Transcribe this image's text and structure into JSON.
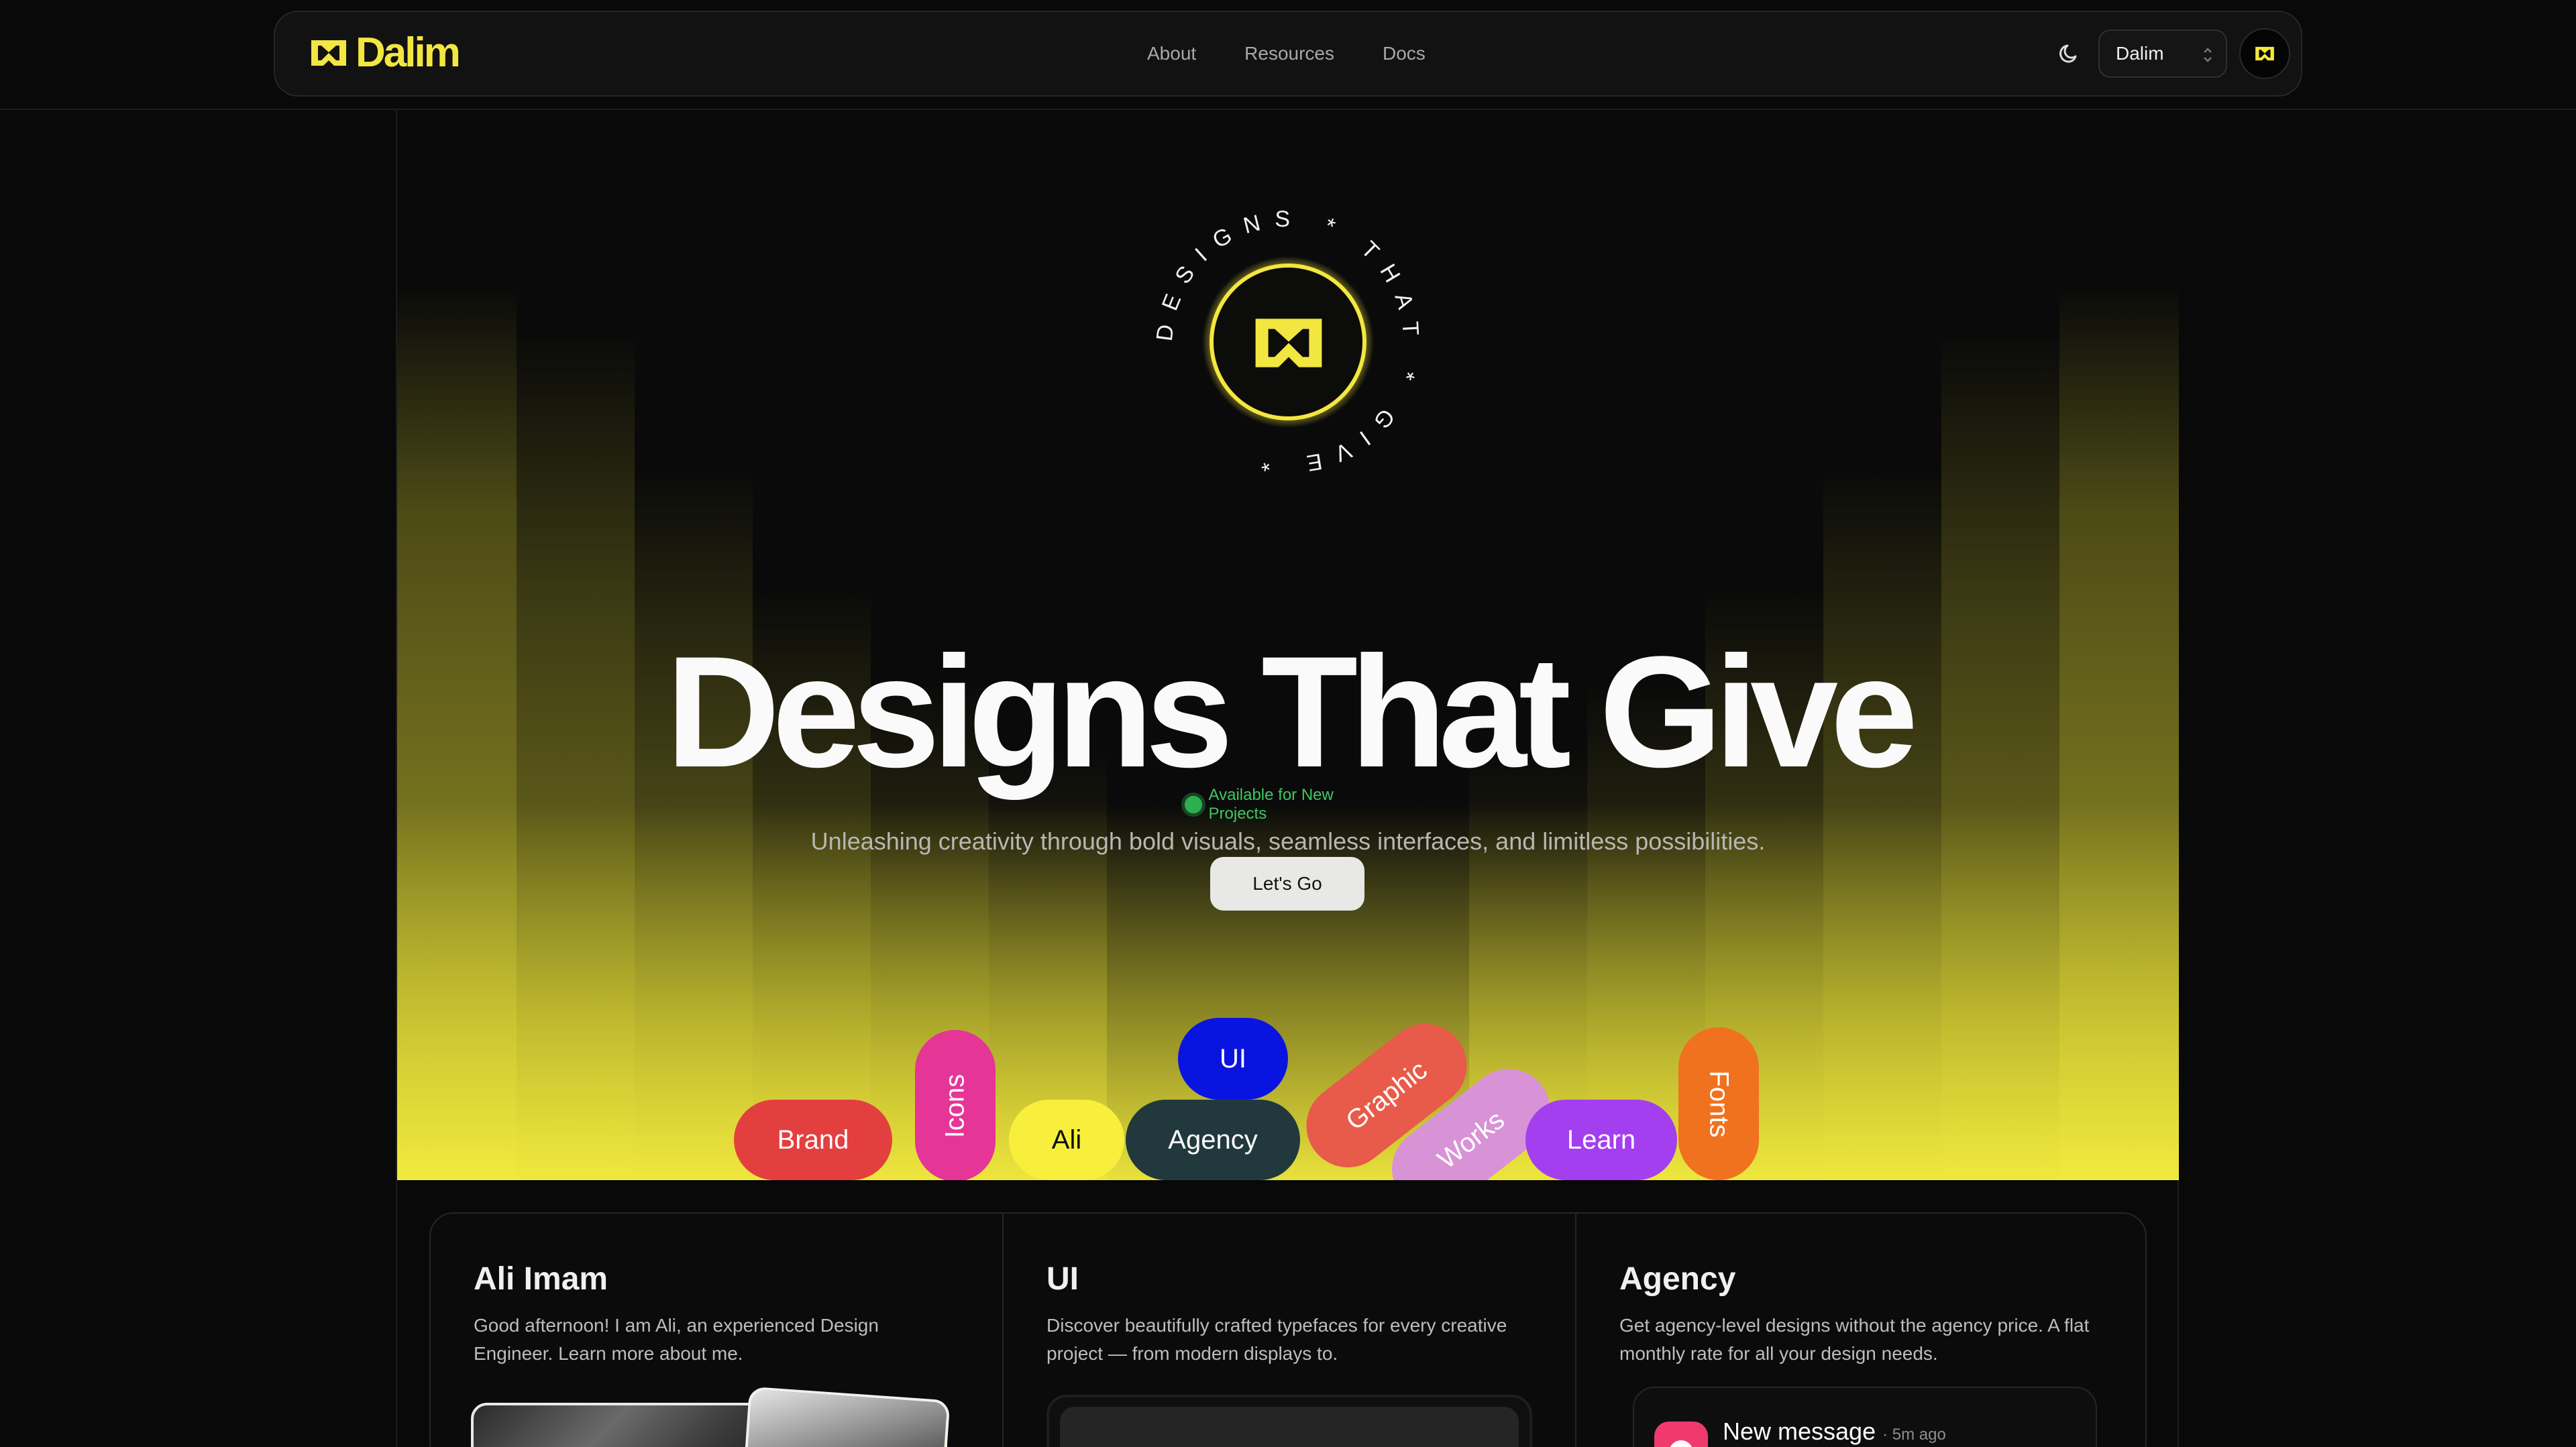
{
  "colors": {
    "accent": "#f2e640",
    "background": "#090909",
    "status": "#3fc862"
  },
  "nav": {
    "brand": "Dalim",
    "links": [
      "About",
      "Resources",
      "Docs"
    ],
    "select_value": "Dalim",
    "theme_icon": "moon-icon"
  },
  "hero": {
    "badge_text": "DESIGNS * THAT * GIVE *",
    "title": "Designs That Give",
    "subtitle": "Unleashing creativity through bold visuals, seamless interfaces, and limitless possibilities.",
    "status": "Available for New Projects",
    "cta": "Let's Go",
    "pills": [
      "Brand",
      "Icons",
      "Ali",
      "UI",
      "Agency",
      "Graphic",
      "Works",
      "Learn",
      "Fonts"
    ],
    "pill_colors": {
      "brand": "#e43f3f",
      "icons": "#e53597",
      "ali": "#f7ef3c",
      "ui": "#0a14e0",
      "agency": "#21393d",
      "graphic": "#e85a49",
      "works": "#d892d6",
      "learn": "#a33fef",
      "fonts": "#f0721e"
    }
  },
  "cards": [
    {
      "title": "Ali Imam",
      "body": "Good afternoon! I am Ali, an experienced Design Engineer. Learn more about me."
    },
    {
      "title": "UI",
      "body": "Discover beautifully crafted typefaces for every creative project — from modern displays to."
    },
    {
      "title": "Agency",
      "body": "Get agency-level designs without the agency price. A flat monthly rate for all your design needs.",
      "notification": {
        "title": "New message",
        "time": "5m ago"
      }
    }
  ]
}
